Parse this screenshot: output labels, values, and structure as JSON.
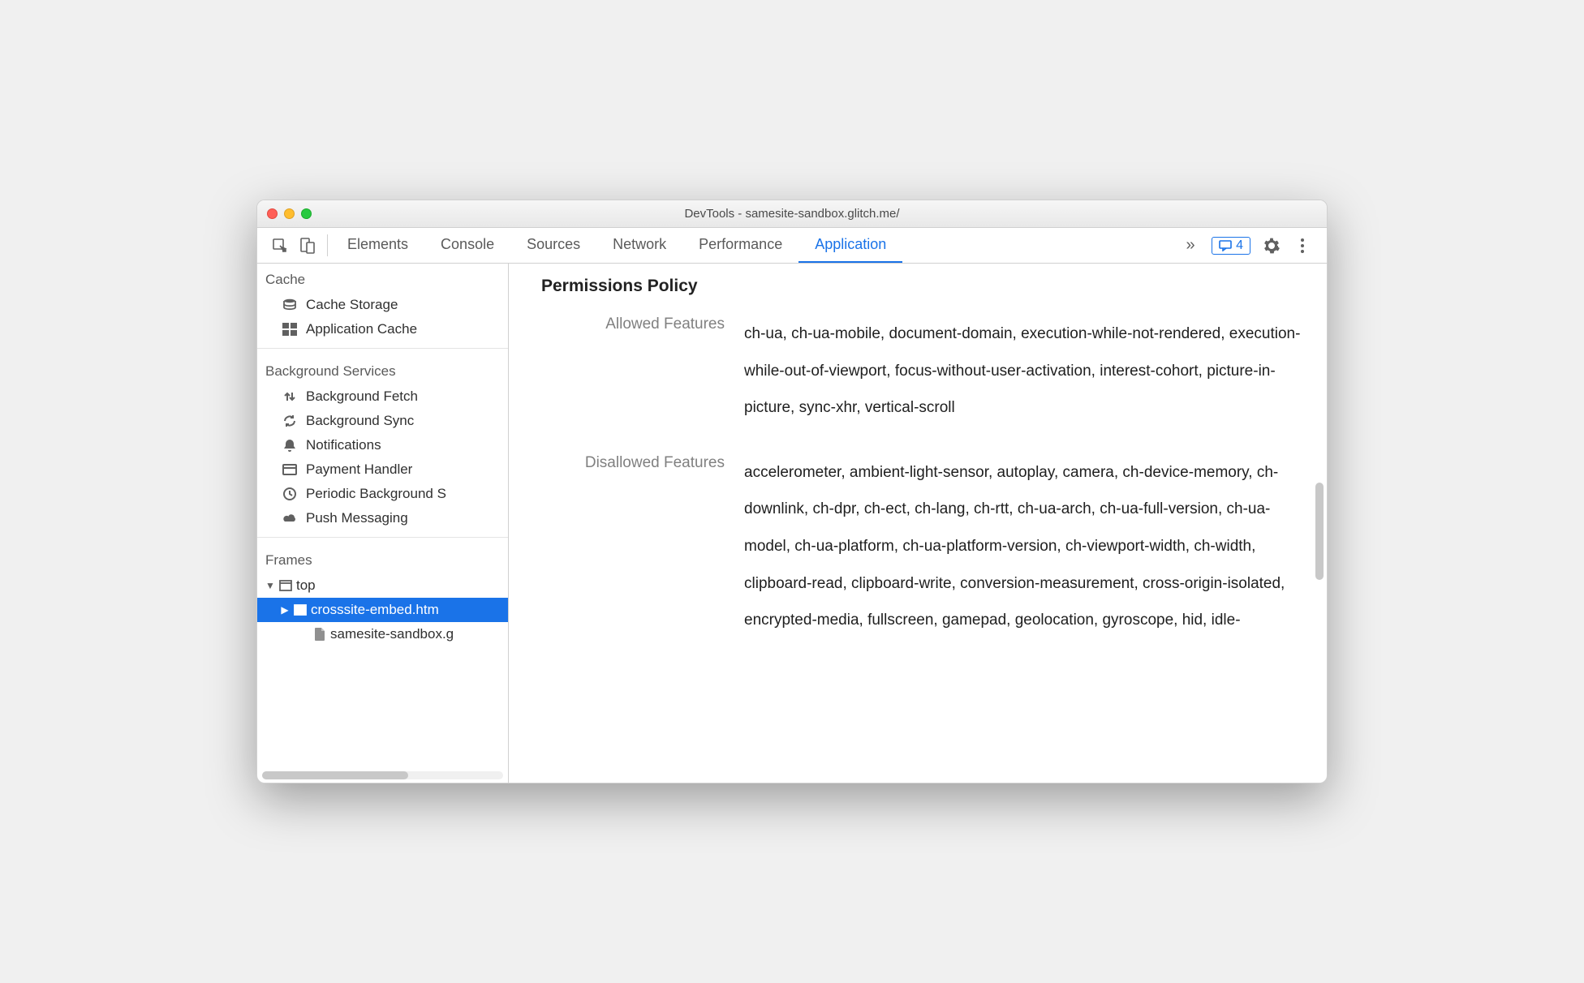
{
  "window": {
    "title": "DevTools - samesite-sandbox.glitch.me/"
  },
  "tabs": {
    "items": [
      "Elements",
      "Console",
      "Sources",
      "Network",
      "Performance",
      "Application"
    ],
    "active": "Application",
    "overflow_icon": "»",
    "message_count": "4"
  },
  "sidebar": {
    "sections": [
      {
        "header": "Cache",
        "items": [
          {
            "icon": "db-icon",
            "label": "Cache Storage"
          },
          {
            "icon": "grid-icon",
            "label": "Application Cache"
          }
        ]
      },
      {
        "header": "Background Services",
        "items": [
          {
            "icon": "updown-icon",
            "label": "Background Fetch"
          },
          {
            "icon": "sync-icon",
            "label": "Background Sync"
          },
          {
            "icon": "bell-icon",
            "label": "Notifications"
          },
          {
            "icon": "card-icon",
            "label": "Payment Handler"
          },
          {
            "icon": "clock-icon",
            "label": "Periodic Background S"
          },
          {
            "icon": "cloud-icon",
            "label": "Push Messaging"
          }
        ]
      },
      {
        "header": "Frames",
        "tree": [
          {
            "depth": 1,
            "disclosure": "▼",
            "icon": "window-icon",
            "label": "top"
          },
          {
            "depth": 2,
            "disclosure": "▶",
            "icon": "frame-icon",
            "label": "crosssite-embed.htm",
            "selected": true
          },
          {
            "depth": 3,
            "disclosure": "",
            "icon": "file-icon",
            "label": "samesite-sandbox.g"
          }
        ]
      }
    ]
  },
  "main": {
    "heading": "Permissions Policy",
    "rows": [
      {
        "label": "Allowed Features",
        "value": "ch-ua, ch-ua-mobile, document-domain, execution-while-not-rendered, execution-while-out-of-viewport, focus-without-user-activation, interest-cohort, picture-in-picture, sync-xhr, vertical-scroll"
      },
      {
        "label": "Disallowed Features",
        "value": "accelerometer, ambient-light-sensor, autoplay, camera, ch-device-memory, ch-downlink, ch-dpr, ch-ect, ch-lang, ch-rtt, ch-ua-arch, ch-ua-full-version, ch-ua-model, ch-ua-platform, ch-ua-platform-version, ch-viewport-width, ch-width, clipboard-read, clipboard-write, conversion-measurement, cross-origin-isolated, encrypted-media, fullscreen, gamepad, geolocation, gyroscope, hid, idle-"
      }
    ]
  }
}
